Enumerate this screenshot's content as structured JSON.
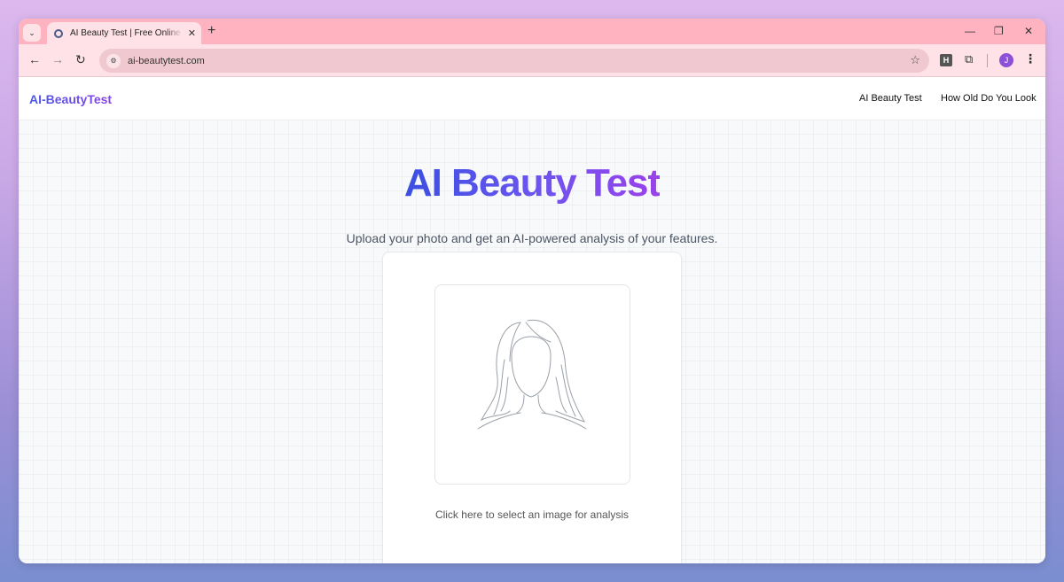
{
  "browser": {
    "tab_title": "AI Beauty Test | Free Online Beauty Test",
    "tab_close": "✕",
    "new_tab": "+",
    "url": "ai-beautytest.com",
    "profile_initial": "J",
    "extension_letter": "H"
  },
  "site": {
    "logo": "AI-BeautyTest",
    "nav": [
      "AI Beauty Test",
      "How Old Do You Look"
    ],
    "title": "AI Beauty Test",
    "subtitle": "Upload your photo and get an AI-powered analysis of your features.",
    "upload_caption": "Click here to select an image for analysis"
  },
  "icons": {
    "tab_search": "chevron-down-icon",
    "back": "back-arrow-icon",
    "forward": "forward-arrow-icon",
    "reload": "reload-icon",
    "site_info": "tune-icon",
    "bookmark": "star-icon",
    "extensions": "puzzle-icon",
    "menu": "more-vert-icon",
    "upload_placeholder": "woman-face-outline-icon"
  },
  "colors": {
    "accent_start": "#3b4fe0",
    "accent_end": "#9a42ea",
    "tab_strip": "#ffb3c1",
    "toolbar": "#ffe2e7",
    "avatar": "#8b4fd8"
  }
}
